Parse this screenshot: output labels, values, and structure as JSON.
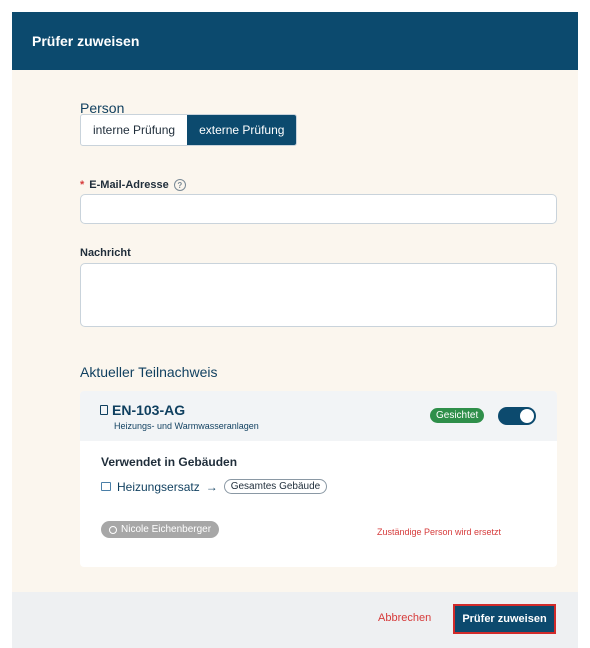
{
  "header": {
    "title": "Prüfer zuweisen"
  },
  "person": {
    "section_title": "Person",
    "toggle_internal": "interne Prüfung",
    "toggle_external": "externe Prüfung",
    "selected": "externe Prüfung"
  },
  "email": {
    "required_mark": "*",
    "label": "E-Mail-Adresse",
    "help": "?",
    "value": "",
    "placeholder": ""
  },
  "message": {
    "label": "Nachricht",
    "value": "",
    "placeholder": ""
  },
  "current_section": {
    "title": "Aktueller Teilnachweis"
  },
  "card": {
    "code": "EN-103-AG",
    "subtitle": "Heizungs- und Warmwasseranlagen",
    "badge": "Gesichtet",
    "toggle_on": true,
    "used_title": "Verwendet in Gebäuden",
    "building": "Heizungsersatz",
    "arrow": "→",
    "scope": "Gesamtes Gebäude",
    "person_chip": "Nicole Eichenberger",
    "replace_note": "Zuständige Person wird ersetzt"
  },
  "footer": {
    "cancel": "Abbrechen",
    "submit": "Prüfer zuweisen"
  },
  "colors": {
    "primary": "#0c4a6e",
    "accent_red": "#d63b3b",
    "success": "#2f8f4a",
    "background": "#fbf6ee"
  }
}
